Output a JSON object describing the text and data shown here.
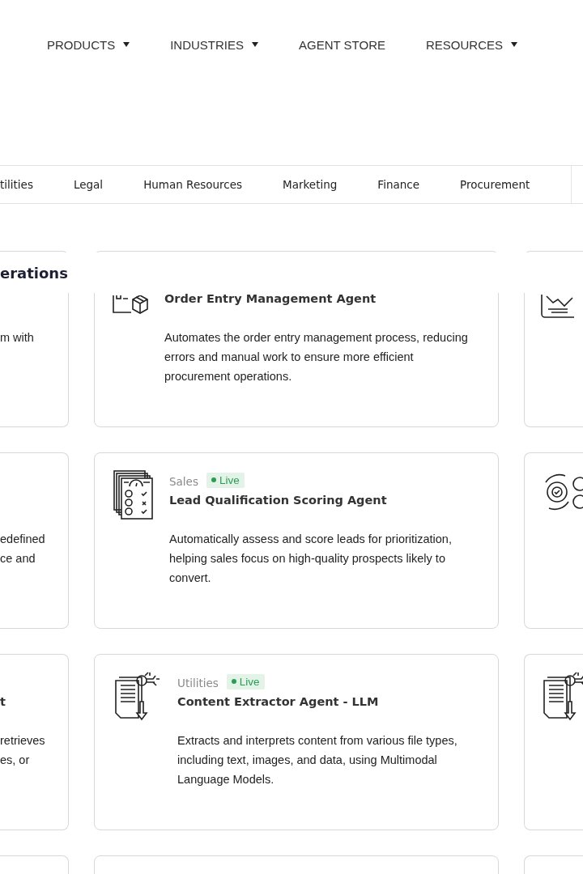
{
  "nav": [
    {
      "label": "PRODUCTS",
      "has_dropdown": true
    },
    {
      "label": "INDUSTRIES",
      "has_dropdown": true
    },
    {
      "label": "AGENT STORE",
      "has_dropdown": false
    },
    {
      "label": "RESOURCES",
      "has_dropdown": true
    }
  ],
  "tabs": [
    {
      "label": "tilities",
      "selected": false
    },
    {
      "label": "Legal",
      "selected": false
    },
    {
      "label": "Human Resources",
      "selected": false
    },
    {
      "label": "Marketing",
      "selected": false
    },
    {
      "label": "Finance",
      "selected": false
    },
    {
      "label": "Procurement",
      "selected": false
    }
  ],
  "section_heading": "erations",
  "rows": [
    {
      "left": {
        "lines": [
          "m with"
        ]
      },
      "center": {
        "title": "Order Entry Management Agent",
        "description": "Automates the order entry management process, reducing errors and manual work to ensure more efficient procurement operations."
      }
    },
    {
      "left": {
        "lines": [
          "edefined",
          "ce and"
        ]
      },
      "center": {
        "category": "Sales",
        "status": "Live",
        "title": "Lead Qualification Scoring Agent",
        "description": "Automatically assess and score leads for prioritization, helping sales focus on high-quality prospects likely to convert."
      }
    },
    {
      "left": {
        "title": "t",
        "lines": [
          "retrieves",
          "es, or"
        ]
      },
      "center": {
        "category": "Utilities",
        "status": "Live",
        "title": "Content Extractor Agent - LLM",
        "description": "Extracts and interprets content from various file types, including text, images, and data, using Multimodal Language Models."
      }
    }
  ]
}
